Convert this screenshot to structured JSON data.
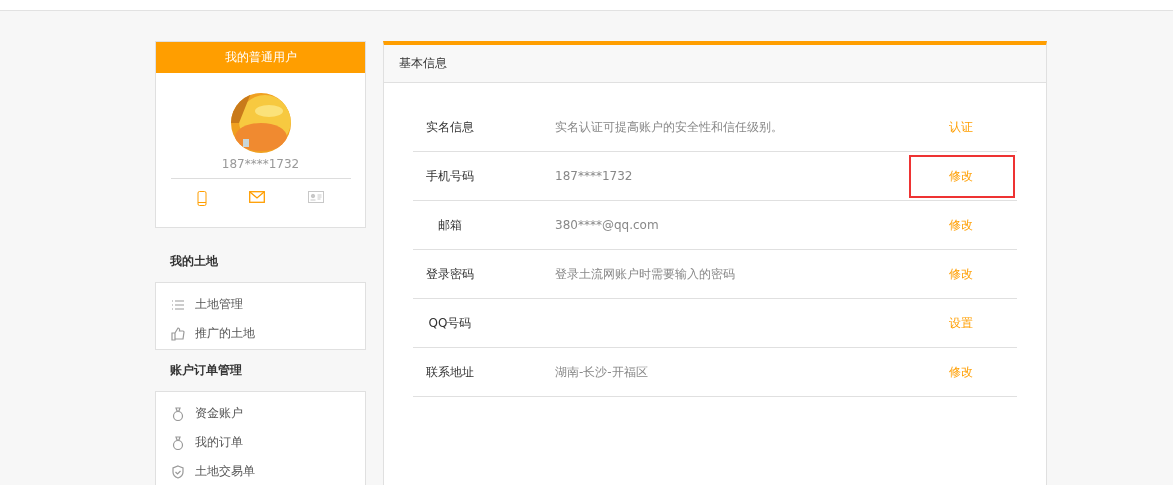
{
  "user_card": {
    "title": "我的普通用户",
    "phone": "187****1732",
    "bindings": [
      {
        "bound": true
      },
      {
        "bound": true
      },
      {
        "bound": false
      }
    ]
  },
  "menu": [
    {
      "title": "我的土地",
      "items": [
        {
          "label": "土地管理"
        },
        {
          "label": "推广的土地"
        }
      ]
    },
    {
      "title": "账户订单管理",
      "items": [
        {
          "label": "资金账户"
        },
        {
          "label": "我的订单"
        },
        {
          "label": "土地交易单"
        }
      ]
    }
  ],
  "panel": {
    "title": "基本信息",
    "rows": [
      {
        "label": "实名信息",
        "value": "实名认证可提高账户的安全性和信任级别。",
        "action": "认证",
        "highlighted": false
      },
      {
        "label": "手机号码",
        "value": "187****1732",
        "action": "修改",
        "highlighted": true
      },
      {
        "label": "邮箱",
        "value": "380****@qq.com",
        "action": "修改",
        "highlighted": false
      },
      {
        "label": "登录密码",
        "value": "登录土流网账户时需要输入的密码",
        "action": "修改",
        "highlighted": false
      },
      {
        "label": "QQ号码",
        "action": "设置",
        "highlighted": false
      },
      {
        "label": "联系地址",
        "value": "湖南-长沙-开福区",
        "action": "修改",
        "highlighted": false
      }
    ]
  }
}
